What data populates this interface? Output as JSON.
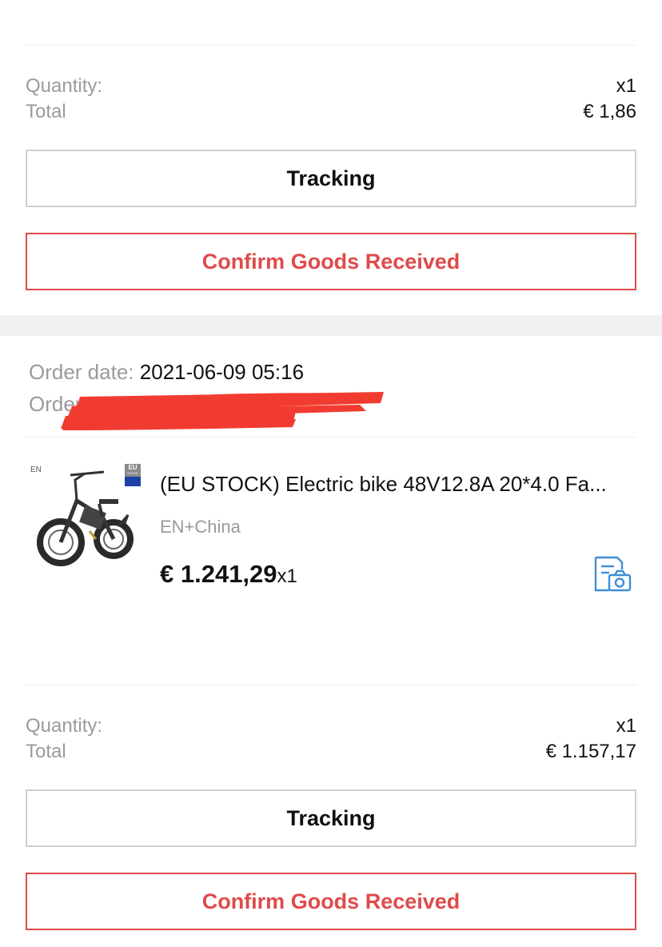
{
  "order1": {
    "quantity_label": "Quantity:",
    "quantity_value": "x1",
    "total_label": "Total",
    "total_value": "€ 1,86",
    "tracking_label": "Tracking",
    "confirm_label": "Confirm Goods Received"
  },
  "order2": {
    "order_date_label": "Order date:",
    "order_date_value": "2021-06-09 05:16",
    "order_id_label": "Order I",
    "item": {
      "badge_en": "EN",
      "badge_eu_line1": "EU",
      "badge_eu_line2": "STOCK",
      "title": "(EU STOCK) Electric bike 48V12.8A 20*4.0 Fa...",
      "variant": "EN+China",
      "price": "€ 1.241,29",
      "price_qty": "x1"
    },
    "quantity_label": "Quantity:",
    "quantity_value": "x1",
    "total_label": "Total",
    "total_value": "€ 1.157,17",
    "tracking_label": "Tracking",
    "confirm_label": "Confirm Goods Received"
  },
  "colors": {
    "accent_red": "#e04a4a",
    "muted_text": "#9a9a9a",
    "redaction": "#f23b30",
    "snapshot_icon": "#3d8fd6"
  },
  "icons": [
    "snapshot-icon",
    "eu-flag-icon",
    "product-image"
  ]
}
